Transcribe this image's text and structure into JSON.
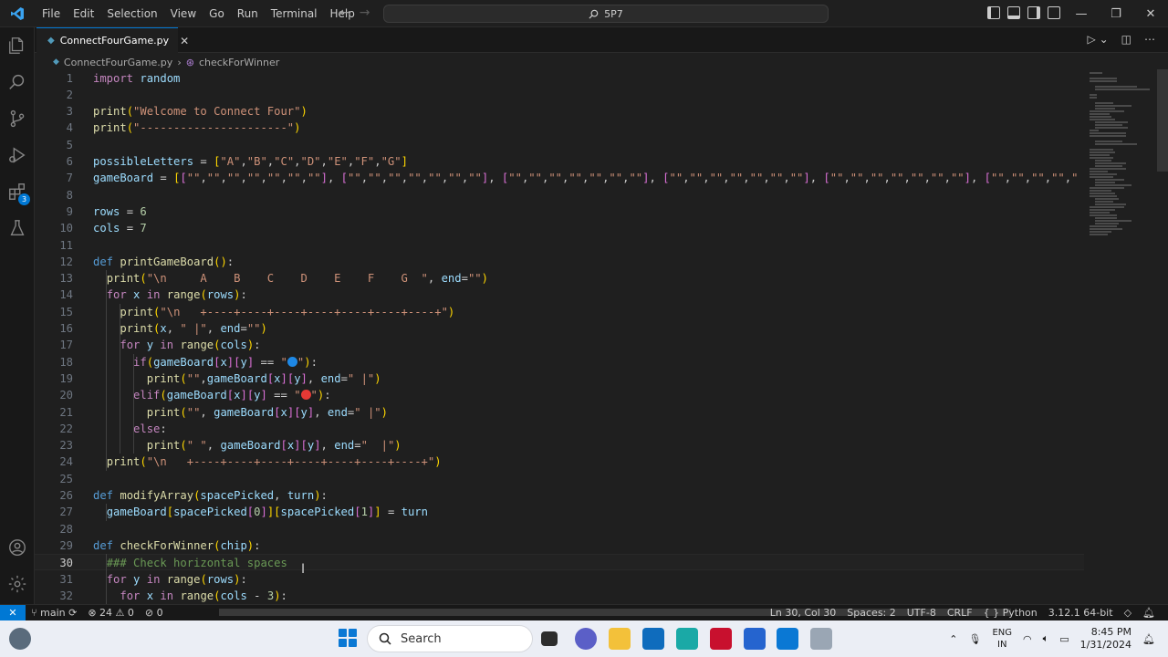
{
  "titlebar": {
    "menu": [
      "File",
      "Edit",
      "Selection",
      "View",
      "Go",
      "Run",
      "Terminal",
      "Help"
    ],
    "search_text": "5P7",
    "back_icon": "arrow-left-icon",
    "forward_icon": "arrow-right-icon"
  },
  "tab": {
    "filename": "ConnectFourGame.py",
    "close_glyph": "✕"
  },
  "breadcrumb": {
    "file": "ConnectFourGame.py",
    "symbol": "checkForWinner"
  },
  "activity_badge": "3",
  "editor": {
    "current_line": 30,
    "lines": [
      {
        "n": "1",
        "t": "import random"
      },
      {
        "n": "2",
        "t": ""
      },
      {
        "n": "3",
        "t": "print(\"Welcome to Connect Four\")"
      },
      {
        "n": "4",
        "t": "print(\"----------------------\")"
      },
      {
        "n": "5",
        "t": ""
      },
      {
        "n": "6",
        "t": "possibleLetters = [\"A\",\"B\",\"C\",\"D\",\"E\",\"F\",\"G\"]"
      },
      {
        "n": "7",
        "t": "gameBoard = [[\"\",\"\",\"\",\"\",\"\",\"\",\"\"], [\"\",\"\",\"\",\"\",\"\",\"\",\"\"], [\"\",\"\",\"\",\"\",\"\",\"\",\"\"], [\"\",\"\",\"\",\"\",\"\",\"\",\"\"], [\"\",\"\",\"\",\"\",\"\",\"\",\"\"], [\"\",\"\",\"\",\"\",\""
      },
      {
        "n": "8",
        "t": ""
      },
      {
        "n": "9",
        "t": "rows = 6"
      },
      {
        "n": "10",
        "t": "cols = 7"
      },
      {
        "n": "11",
        "t": ""
      },
      {
        "n": "12",
        "t": "def printGameBoard():"
      },
      {
        "n": "13",
        "t": "  print(\"\\n     A    B    C    D    E    F    G  \", end=\"\")"
      },
      {
        "n": "14",
        "t": "  for x in range(rows):"
      },
      {
        "n": "15",
        "t": "    print(\"\\n   +----+----+----+----+----+----+----+\")"
      },
      {
        "n": "16",
        "t": "    print(x, \" |\", end=\"\")"
      },
      {
        "n": "17",
        "t": "    for y in range(cols):"
      },
      {
        "n": "18",
        "t": "      if(gameBoard[x][y] == \"🔵\"):"
      },
      {
        "n": "19",
        "t": "        print(\"\",gameBoard[x][y], end=\" |\")"
      },
      {
        "n": "20",
        "t": "      elif(gameBoard[x][y] == \"🔴\"):"
      },
      {
        "n": "21",
        "t": "        print(\"\", gameBoard[x][y], end=\" |\")"
      },
      {
        "n": "22",
        "t": "      else:"
      },
      {
        "n": "23",
        "t": "        print(\" \", gameBoard[x][y], end=\"  |\")"
      },
      {
        "n": "24",
        "t": "  print(\"\\n   +----+----+----+----+----+----+----+\")"
      },
      {
        "n": "25",
        "t": ""
      },
      {
        "n": "26",
        "t": "def modifyArray(spacePicked, turn):"
      },
      {
        "n": "27",
        "t": "  gameBoard[spacePicked[0]][spacePicked[1]] = turn"
      },
      {
        "n": "28",
        "t": ""
      },
      {
        "n": "29",
        "t": "def checkForWinner(chip):"
      },
      {
        "n": "30",
        "t": "  ### Check horizontal spaces"
      },
      {
        "n": "31",
        "t": "  for y in range(rows):"
      },
      {
        "n": "32",
        "t": "    for x in range(cols - 3):"
      }
    ]
  },
  "statusbar": {
    "branch": "main",
    "errors": "24",
    "warnings": "0",
    "ports": "0",
    "position": "Ln 30, Col 30",
    "spaces": "Spaces: 2",
    "encoding": "UTF-8",
    "eol": "CRLF",
    "language": "Python",
    "interpreter": "3.12.1 64-bit"
  },
  "taskbar": {
    "search_placeholder": "Search",
    "lang_top": "ENG",
    "lang_bottom": "IN",
    "time": "8:45 PM",
    "date": "1/31/2024"
  },
  "colors": {
    "accent": "#0078d4",
    "keyword": "#c586c0",
    "function": "#dcdcaa",
    "string": "#ce9178",
    "comment": "#6a9955"
  }
}
